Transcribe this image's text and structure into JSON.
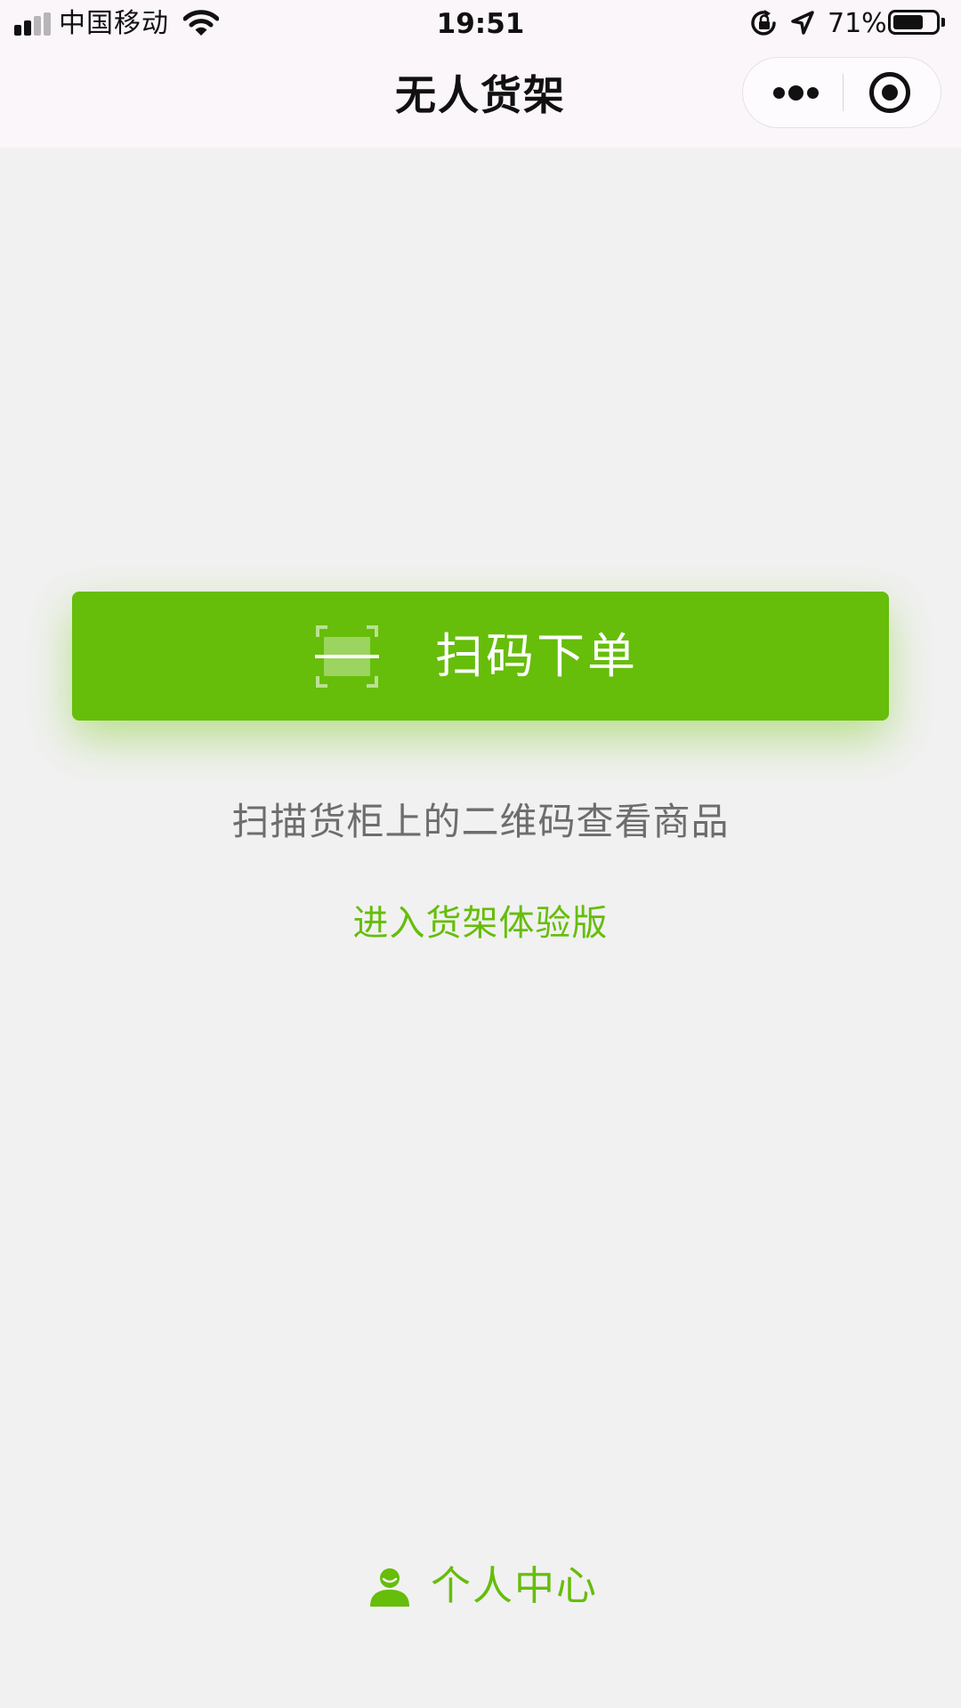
{
  "status_bar": {
    "carrier": "中国移动",
    "time": "19:51",
    "battery_percent": "71%",
    "battery_level": 0.71,
    "signal_bars_filled": 2,
    "signal_bars_total": 4,
    "icons": [
      "signal-icon",
      "wifi-icon",
      "rotation-lock-icon",
      "location-arrow-icon",
      "battery-icon"
    ]
  },
  "nav": {
    "title": "无人货架",
    "icons": [
      "more-icon",
      "close-miniprogram-icon"
    ]
  },
  "main": {
    "scan_button_label": "扫码下单",
    "scan_icon": "scan-frame-icon",
    "hint": "扫描货柜上的二维码查看商品",
    "trial_link": "进入货架体验版"
  },
  "footer": {
    "profile_label": "个人中心",
    "profile_icon": "user-icon"
  },
  "colors": {
    "accent": "#66bd0a",
    "hint_text": "#6d6d6d",
    "background": "#f1f1f1",
    "top_bar": "#fbf6fa",
    "text": "#111111"
  }
}
